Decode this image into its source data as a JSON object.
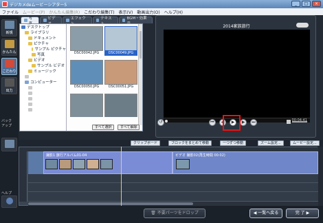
{
  "window": {
    "title": "デジカメdeムービーシアター5",
    "buttons": {
      "minimize": "_",
      "maximize": "□",
      "close": "×"
    }
  },
  "menu": [
    {
      "label": "ファイル",
      "enabled": true
    },
    {
      "label": "ムービー(P)",
      "enabled": false
    },
    {
      "label": "かんたん編集(R)",
      "enabled": false
    },
    {
      "label": "こだわり編集(T)",
      "enabled": true
    },
    {
      "label": "表示(V)",
      "enabled": true
    },
    {
      "label": "動画出力(O)",
      "enabled": true
    },
    {
      "label": "ヘルプ(H)",
      "enabled": true
    }
  ],
  "left_rail": {
    "items": [
      {
        "label": "新規",
        "icon": "new-project-icon"
      },
      {
        "label": "かんたん",
        "icon": "easy-edit-icon"
      },
      {
        "label": "こだわり",
        "icon": "advanced-edit-icon"
      },
      {
        "label": "出力",
        "icon": "output-icon"
      }
    ],
    "bottom_labels": [
      "バック",
      "アップ",
      "ヘルプ"
    ]
  },
  "material_tabs": [
    {
      "label": "写真",
      "active": true
    },
    {
      "label": "ビデオ",
      "active": false
    },
    {
      "label": "エフェクト",
      "active": false
    },
    {
      "label": "テキスト",
      "active": false
    },
    {
      "label": "BGM・効果音",
      "active": false
    }
  ],
  "folder_tree": [
    {
      "label": "デスクトップ",
      "indent": 0,
      "color": "#4a7cc4"
    },
    {
      "label": "ライブラリ",
      "indent": 1,
      "color": "#e7c24b"
    },
    {
      "label": "ドキュメント",
      "indent": 2,
      "color": "#e7c24b"
    },
    {
      "label": "ピクチャ",
      "indent": 2,
      "color": "#e7c24b"
    },
    {
      "label": "サンプル ピクチャ",
      "indent": 3,
      "color": "#e7c24b"
    },
    {
      "label": "写真",
      "indent": 3,
      "color": "#e7c24b"
    },
    {
      "label": "ビデオ",
      "indent": 2,
      "color": "#e7c24b"
    },
    {
      "label": "サンプル ビデオ",
      "indent": 3,
      "color": "#e7c24b"
    },
    {
      "label": "ミュージック",
      "indent": 2,
      "color": "#e7c24b"
    },
    {
      "label": "",
      "indent": 1,
      "color": "#c8c8c8"
    },
    {
      "label": "コンピューター",
      "indent": 1,
      "color": "#7ea4d4"
    },
    {
      "label": "",
      "indent": 2,
      "color": "#c8c8c8"
    },
    {
      "label": "",
      "indent": 2,
      "color": "#c8c8c8"
    },
    {
      "label": "",
      "indent": 2,
      "color": "#c8c8c8"
    },
    {
      "label": "",
      "indent": 2,
      "color": "#c8c8c8"
    },
    {
      "label": "",
      "indent": 2,
      "color": "#c8c8c8"
    }
  ],
  "thumbnails": [
    {
      "name": "DSC00042.JPG",
      "selected": false,
      "bg": "#8b9da8"
    },
    {
      "name": "DSC00049.JPG",
      "selected": true,
      "bg": "#b5c7d4"
    },
    {
      "name": "DSC00050.JPG",
      "selected": false,
      "bg": "#5f8fb8"
    },
    {
      "name": "DSC00051.JPG",
      "selected": false,
      "bg": "#c89a7a"
    },
    {
      "name": "",
      "selected": false,
      "bg": "#7f8f99"
    },
    {
      "name": "",
      "selected": false,
      "bg": "#6d7d88"
    }
  ],
  "select_all_label": "すべて選択",
  "deselect_all_label": "すべて解除",
  "preview": {
    "title": "2014家族旅行",
    "time": "00:04:41"
  },
  "timeline_toolbar": {
    "clipboard_label": "クリップボード",
    "move_block_label": "ブロックをまとめて移動",
    "one_step_move_label": "一つずつ移動",
    "resize_label": "ズーム設定...",
    "movie_settings_label": "ムービー設定..."
  },
  "timeline": {
    "clip1_label": "撮影1 旅行アルバム01-04",
    "clip2_label": "ビデオ 撮影02(再生時間 00:02)",
    "clip_thumbs": [
      "#6f8aa0",
      "#b89a7c",
      "#8fa3b0",
      "#d0b090",
      "#7b94a6"
    ]
  },
  "drop_hint": "不要パーツをドロップ",
  "nav": {
    "back_label": "一覧へ戻る",
    "finish_label": "完 了"
  },
  "colors": {
    "highlight": "#ee1111",
    "accent": "#4d6e99"
  }
}
